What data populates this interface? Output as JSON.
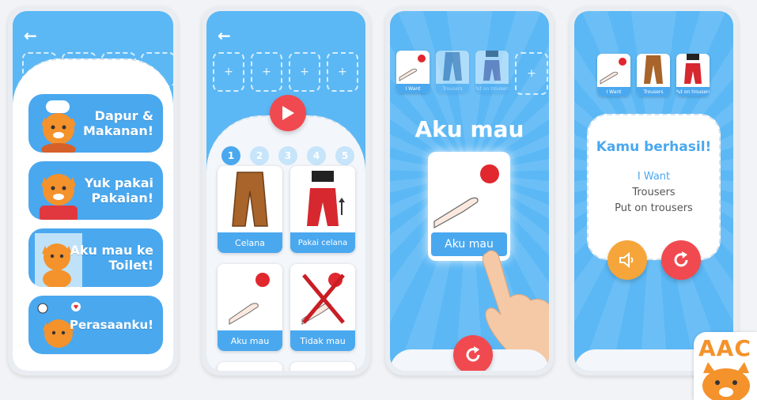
{
  "screen1": {
    "categories": [
      {
        "line1": "Dapur &",
        "line2": "Makanan!"
      },
      {
        "line1": "Yuk pakai",
        "line2": "Pakaian!"
      },
      {
        "line1": "Aku mau ke",
        "line2": "Toilet!"
      },
      {
        "line1": "Perasaanku!",
        "line2": ""
      }
    ]
  },
  "screen2": {
    "slot_plus": "+",
    "steps": [
      "1",
      "2",
      "3",
      "4",
      "5"
    ],
    "cards": [
      "Celana",
      "Pakai celana",
      "Aku mau",
      "Tidak mau"
    ]
  },
  "screen3": {
    "sentence_cards": [
      "I Want",
      "Trousers",
      "Put on trousers"
    ],
    "slot_plus": "+",
    "phrase": "Aku mau",
    "big_card_label": "Aku mau"
  },
  "screen4": {
    "sentence_cards": [
      "I Want",
      "Trousers",
      "Put on trousers"
    ],
    "success_title": "Kamu berhasil!",
    "lines": [
      "I Want",
      "Trousers",
      "Put on trousers"
    ]
  },
  "app_logo_text": "AAC",
  "colors": {
    "primary_blue": "#5bb8f5",
    "card_blue": "#4aa8ef",
    "red": "#f04a50",
    "orange": "#f5a53a"
  }
}
